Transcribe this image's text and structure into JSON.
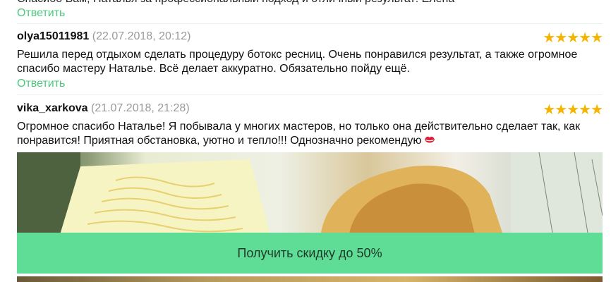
{
  "prev_review": {
    "text_clipped": "Спасибо Вам, Наталья за профессиональный подход и отличный результат! Елена",
    "reply_label": "Ответить"
  },
  "reviews": [
    {
      "author": "olya15011981",
      "date": "(22.07.2018, 20:12)",
      "stars": "★★★★★",
      "text": "Решила перед отдыхом сделать процедуру ботокс ресниц. Очень понравился результат, а также огромное спасибо мастеру Наталье. Всё делает аккуратно. Обязательно пойду ещё.",
      "reply_label": "Ответить"
    },
    {
      "author": "vika_xarkova",
      "date": "(21.07.2018, 21:28)",
      "stars": "★★★★★",
      "text": "Огромное спасибо Наталье! Я побывала у многих мастеров, но только она действительно сделает так, как понравится! Приятная обстановка, уютно и тепло!!! Однозначно рекомендую",
      "emoji": "lips-icon"
    }
  ],
  "promo_button": {
    "label": "Получить скидку до 50%"
  },
  "colors": {
    "accent_green": "#4cc87c",
    "button_green": "#5fdc96",
    "star": "#f5b400",
    "date_gray": "#9a9a9a"
  }
}
